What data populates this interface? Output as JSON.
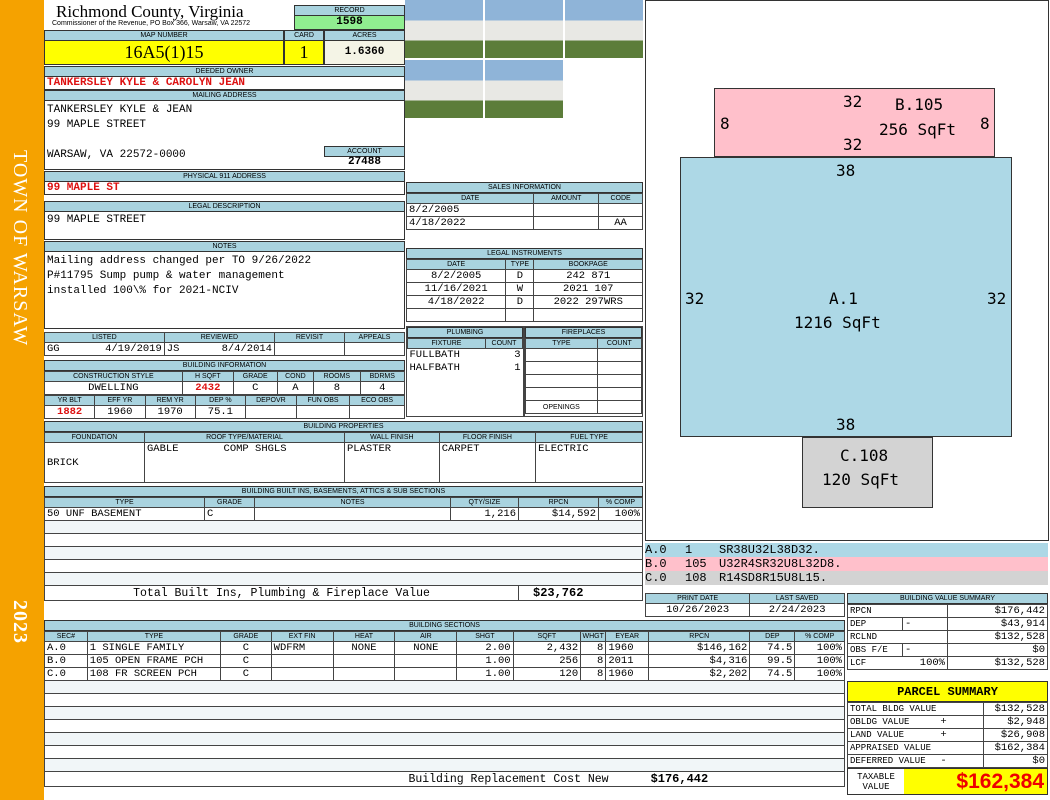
{
  "side": {
    "town": "TOWN OF WARSAW",
    "year": "2023"
  },
  "header": {
    "county": "Richmond County, Virginia",
    "sub": "Commissioner of the Revenue, PO Box 366, Warsaw, VA 22572",
    "record_label": "RECORD",
    "record": "1598",
    "map_label": "MAP NUMBER",
    "map": "16A5(1)15",
    "card_label": "CARD",
    "card": "1",
    "acres_label": "ACRES",
    "acres": "1.6360"
  },
  "owner": {
    "label": "DEEDED OWNER",
    "name": "TANKERSLEY KYLE & CAROLYN JEAN"
  },
  "mailing": {
    "label": "MAILING ADDRESS",
    "line1": "TANKERSLEY KYLE & JEAN",
    "line2": "99 MAPLE STREET",
    "line3": "WARSAW, VA 22572-0000",
    "account_label": "ACCOUNT",
    "account": "27488"
  },
  "physical": {
    "label": "PHYSICAL 911 ADDRESS",
    "value": "99 MAPLE ST"
  },
  "legal": {
    "label": "LEGAL DESCRIPTION",
    "value": "99 MAPLE STREET"
  },
  "notes": {
    "label": "NOTES",
    "lines": [
      "Mailing address changed per TO 9/26/2022",
      "P#11795 Sump pump & water management",
      "installed 100\\% for 2021-NCIV"
    ]
  },
  "review": {
    "listed_label": "LISTED",
    "listed_by": "GG",
    "listed": "4/19/2019",
    "reviewed_label": "REVIEWED",
    "reviewed_by": "JS",
    "reviewed": "8/4/2014",
    "revisit_label": "REVISIT",
    "appeals_label": "APPEALS"
  },
  "bldg": {
    "label": "BUILDING INFORMATION",
    "h1": [
      "CONSTRUCTION STYLE",
      "H SQFT",
      "GRADE",
      "COND",
      "ROOMS",
      "BDRMS"
    ],
    "v1": [
      "DWELLING",
      "2432",
      "C",
      "A",
      "8",
      "4"
    ],
    "h2": [
      "YR BLT",
      "EFF YR",
      "REM YR",
      "DEP %",
      "DEPOVR",
      "FUN OBS",
      "ECO OBS"
    ],
    "v2": [
      "1882",
      "1960",
      "1970",
      "75.1",
      "",
      "",
      ""
    ]
  },
  "sales": {
    "label": "SALES INFORMATION",
    "cols": [
      "DATE",
      "AMOUNT",
      "CODE"
    ],
    "rows": [
      [
        "8/2/2005",
        "",
        ""
      ],
      [
        "4/18/2022",
        "",
        "AA"
      ]
    ]
  },
  "instruments": {
    "label": "LEGAL INSTRUMENTS",
    "cols": [
      "DATE",
      "TYPE",
      "BOOKPAGE"
    ],
    "rows": [
      [
        "8/2/2005",
        "D",
        "242 871"
      ],
      [
        "11/16/2021",
        "W",
        "2021 107"
      ],
      [
        "4/18/2022",
        "D",
        "2022 297WRS"
      ]
    ]
  },
  "plumbing": {
    "label": "PLUMBING",
    "cols": [
      "FIXTURE",
      "COUNT"
    ],
    "rows": [
      [
        "FULLBATH",
        "3"
      ],
      [
        "HALFBATH",
        "1"
      ]
    ]
  },
  "fireplaces": {
    "label": "FIREPLACES",
    "cols": [
      "TYPE",
      "COUNT"
    ],
    "openings": "OPENINGS"
  },
  "props": {
    "label": "BUILDING PROPERTIES",
    "cols": [
      "FOUNDATION",
      "ROOF TYPE/MATERIAL",
      "WALL FINISH",
      "FLOOR FINISH",
      "FUEL TYPE"
    ],
    "foundation": "BRICK",
    "roof1": "GABLE",
    "roof2": "COMP SHGLS",
    "wall": "PLASTER",
    "floor": "CARPET",
    "fuel": "ELECTRIC"
  },
  "builtins": {
    "label": "BUILDING BUILT INS, BASEMENTS, ATTICS & SUB SECTIONS",
    "cols": [
      "TYPE",
      "GRADE",
      "NOTES",
      "QTY/SIZE",
      "RPCN",
      "% COMP"
    ],
    "rows": [
      [
        "50 UNF BASEMENT",
        "C",
        "",
        "1,216",
        "$14,592",
        "100%"
      ]
    ],
    "total_label": "Total Built Ins, Plumbing & Fireplace Value",
    "total": "$23,762"
  },
  "sections": {
    "label": "BUILDING SECTIONS",
    "cols": [
      "SEC#",
      "TYPE",
      "GRADE",
      "EXT FIN",
      "HEAT",
      "AIR",
      "SHGT",
      "SQFT",
      "WHGT",
      "EYEAR",
      "RPCN",
      "DEP",
      "% COMP"
    ],
    "rows": [
      [
        "A.0",
        "1 SINGLE FAMILY",
        "C",
        "WDFRM",
        "NONE",
        "NONE",
        "2.00",
        "2,432",
        "8",
        "1960",
        "$146,162",
        "74.5",
        "100%"
      ],
      [
        "B.0",
        "105 OPEN FRAME PCH",
        "C",
        "",
        "",
        "",
        "1.00",
        "256",
        "8",
        "2011",
        "$4,316",
        "99.5",
        "100%"
      ],
      [
        "C.0",
        "108 FR SCREEN PCH",
        "C",
        "",
        "",
        "",
        "1.00",
        "120",
        "8",
        "1960",
        "$2,202",
        "74.5",
        "100%"
      ]
    ],
    "total_label": "Building Replacement Cost New",
    "total": "$176,442"
  },
  "sketch": {
    "A": {
      "code": "A.1",
      "area": "1216 SqFt",
      "w": "38",
      "h": "32"
    },
    "B": {
      "code": "B.105",
      "area": "256 SqFt",
      "w": "32",
      "h": "8"
    },
    "C": {
      "code": "C.108",
      "area": "120 SqFt"
    },
    "colors": {
      "A": "#add8e6",
      "B": "#ffc0cb",
      "C": "#d3d3d3"
    }
  },
  "codes": [
    [
      "A.0",
      "1",
      "SR38U32L38D32."
    ],
    [
      "B.0",
      "105",
      "U32R4SR32U8L32D8."
    ],
    [
      "C.0",
      "108",
      "R14SD8R15U8L15."
    ]
  ],
  "dates": {
    "print_label": "PRINT DATE",
    "print": "10/26/2023",
    "saved_label": "LAST SAVED",
    "saved": "2/24/2023"
  },
  "bvs": {
    "label": "BUILDING VALUE SUMMARY",
    "rows": [
      [
        "RPCN",
        "",
        "$176,442"
      ],
      [
        "DEP",
        "-",
        "$43,914"
      ],
      [
        "RCLND",
        "",
        "$132,528"
      ],
      [
        "OBS F/E",
        "-",
        "$0"
      ],
      [
        "LCF",
        "100%",
        "$132,528"
      ]
    ]
  },
  "parcel": {
    "label": "PARCEL SUMMARY",
    "rows": [
      [
        "TOTAL BLDG VALUE",
        "",
        "$132,528"
      ],
      [
        "OBLDG VALUE",
        "+",
        "$2,948"
      ],
      [
        "LAND VALUE",
        "+",
        "$26,908"
      ],
      [
        "APPRAISED VALUE",
        "",
        "$162,384"
      ],
      [
        "DEFERRED VALUE",
        "-",
        "$0"
      ]
    ],
    "taxable_label": "TAXABLE VALUE",
    "taxable": "$162,384"
  }
}
